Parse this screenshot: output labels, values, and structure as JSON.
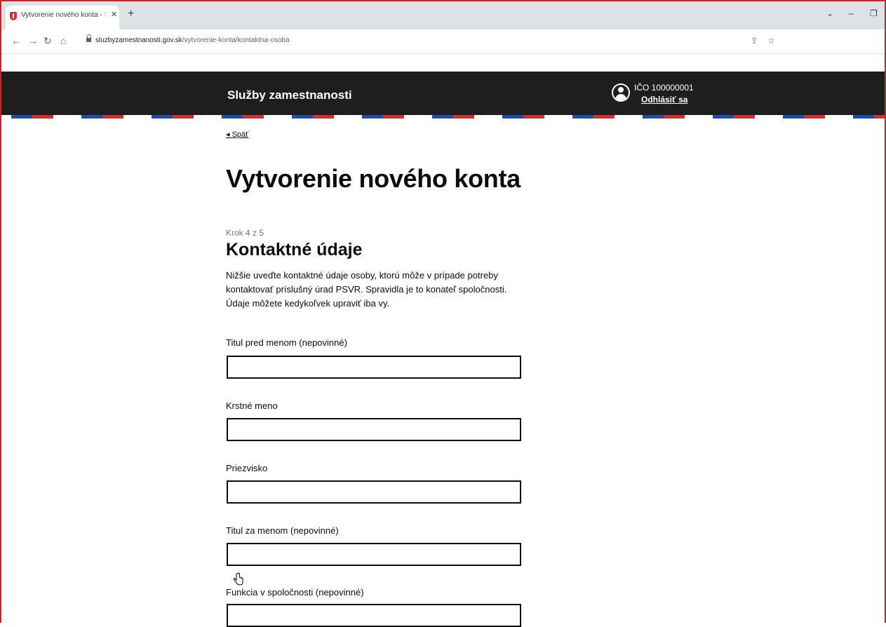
{
  "browser": {
    "tab_title": "Vytvorenie nového konta - Služb",
    "tab_close": "✕",
    "new_tab": "+",
    "url_domain": "sluzbyzamestnanosti.gov.sk",
    "url_path": "/vytvorenie-konta/kontaktna-osoba",
    "icons": [
      "back-icon",
      "forward-icon",
      "reload-icon",
      "home-icon",
      "lock-icon",
      "share-icon",
      "star-icon"
    ]
  },
  "header": {
    "site_title": "Služby zamestnanosti",
    "ico_label": "IČO 100000001",
    "logout": "Odhlásiť sa"
  },
  "colors": {
    "header_bg": "#1e1e1e",
    "stripe_blue": "#1f4fa8",
    "stripe_red": "#d32f2f"
  },
  "main": {
    "back_link": "Späť",
    "page_title": "Vytvorenie nového konta",
    "step": "Krok 4 z 5",
    "section_title": "Kontaktné údaje",
    "intro": "Nižšie uveďte kontaktné údaje osoby, ktorú môže v prípade potreby kontaktovať príslušný úrad PSVR. Spravidla je to konateľ spoločnosti. Údaje môžete kedykoľvek upraviť iba vy.",
    "fields": [
      {
        "label": "Titul pred menom (nepovinné)",
        "value": ""
      },
      {
        "label": "Krstné meno",
        "value": ""
      },
      {
        "label": "Priezvisko",
        "value": ""
      },
      {
        "label": "Titul za menom (nepovinné)",
        "value": ""
      },
      {
        "label": "Funkcia v spoločnosti (nepovinné)",
        "value": ""
      }
    ]
  }
}
